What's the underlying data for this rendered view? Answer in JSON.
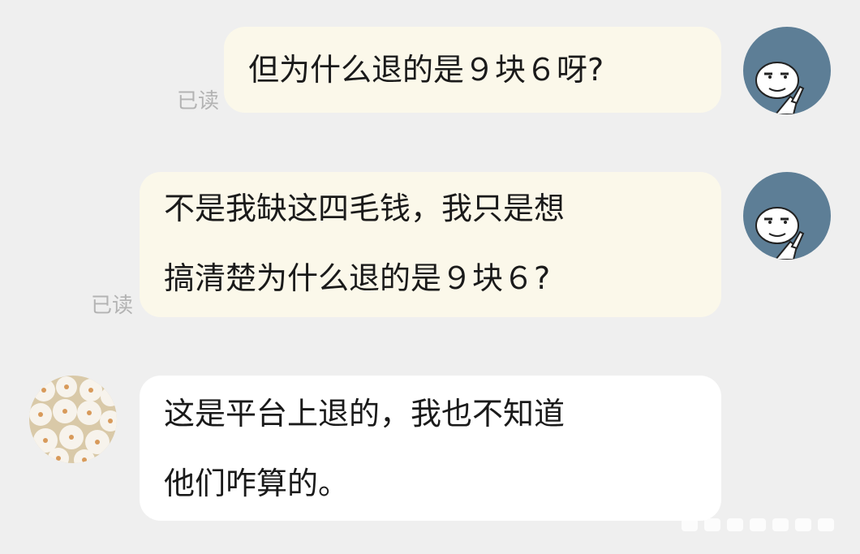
{
  "messages": [
    {
      "direction": "outgoing",
      "lines": [
        "但为什么退的是９块６呀?"
      ],
      "read_receipt": "已读",
      "avatar": "meme-face-avatar-icon"
    },
    {
      "direction": "outgoing",
      "lines": [
        "不是我缺这四毛钱，我只是想",
        "搞清楚为什么退的是９块６?"
      ],
      "read_receipt": "已读",
      "avatar": "meme-face-avatar-icon"
    },
    {
      "direction": "incoming",
      "lines": [
        "这是平台上退的，我也不知道",
        "他们咋算的。"
      ],
      "avatar": "steamed-buns-avatar-icon"
    }
  ],
  "colors": {
    "background": "#efefef",
    "outgoing_bubble": "#fbf8ea",
    "incoming_bubble": "#ffffff",
    "meme_avatar_bg": "#5d7e96",
    "read_receipt_text": "#b3b3b3"
  }
}
